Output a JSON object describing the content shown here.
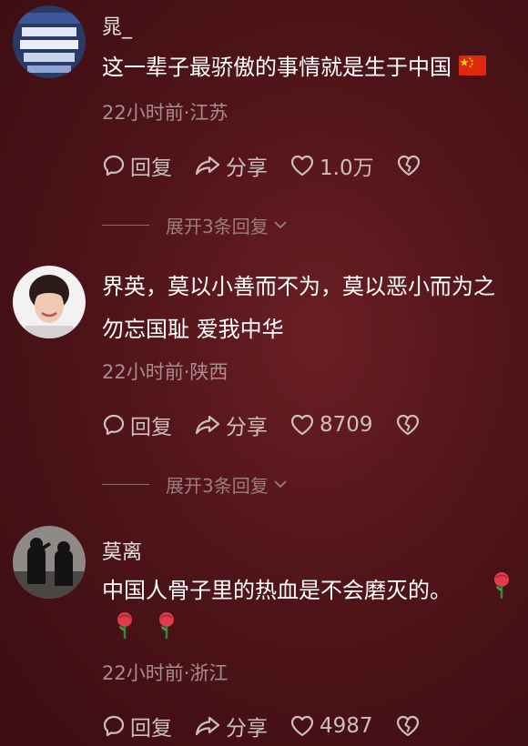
{
  "comments": [
    {
      "username": "晁_",
      "text": "这一辈子最骄傲的事情就是生于中国",
      "emoji": "flag-cn",
      "meta": "22小时前·江苏",
      "reply_label": "回复",
      "share_label": "分享",
      "likes": "1.0万",
      "expand_label": "展开3条回复"
    },
    {
      "username": "",
      "text_line1": "界英，莫以小善而不为，莫以恶小而为之",
      "text_line2": "勿忘国耻 爱我中华",
      "meta": "22小时前·陕西",
      "reply_label": "回复",
      "share_label": "分享",
      "likes": "8709",
      "expand_label": "展开3条回复"
    },
    {
      "username": "莫离",
      "text": "中国人骨子里的热血是不会磨灭的。",
      "emoji": "rose",
      "meta": "22小时前·浙江",
      "reply_label": "回复",
      "share_label": "分享",
      "likes": "4987"
    }
  ],
  "colors": {
    "background": "#4f1419",
    "meta": "#a78d8f",
    "action": "#cdbebf"
  }
}
